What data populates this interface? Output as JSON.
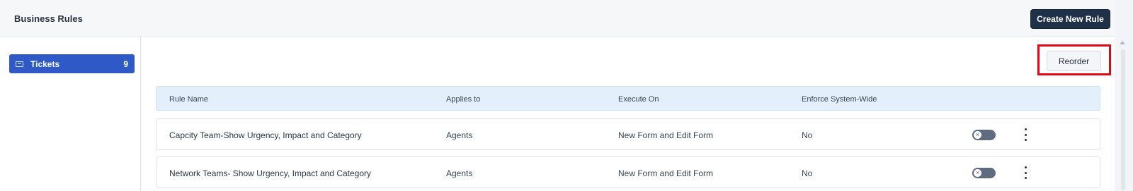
{
  "header": {
    "title": "Business Rules",
    "create_button": "Create New Rule"
  },
  "sidebar": {
    "items": [
      {
        "label": "Tickets",
        "count": "9",
        "icon": "ticket-icon"
      }
    ]
  },
  "toolbar": {
    "reorder_label": "Reorder"
  },
  "table": {
    "columns": [
      "Rule Name",
      "Applies to",
      "Execute On",
      "Enforce System-Wide"
    ],
    "rows": [
      {
        "rule_name": "Capcity Team-Show Urgency, Impact and Category",
        "applies_to": "Agents",
        "execute_on": "New Form and Edit Form",
        "enforce": "No",
        "enabled": false
      },
      {
        "rule_name": "Network Teams- Show Urgency, Impact and Category",
        "applies_to": "Agents",
        "execute_on": "New Form and Edit Form",
        "enforce": "No",
        "enabled": false
      }
    ]
  },
  "colors": {
    "primary_dark": "#1e3149",
    "sidebar_active": "#2f59c6",
    "highlight": "#e30613",
    "table_header_bg": "#e3effb"
  }
}
